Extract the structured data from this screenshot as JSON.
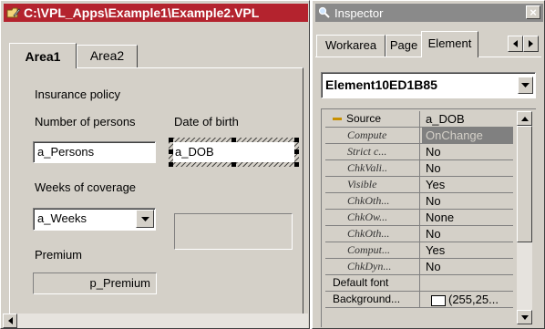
{
  "left_window": {
    "title": "C:\\VPL_Apps\\Example1\\Example2.VPL",
    "tabs": [
      {
        "label": "Area1",
        "active": true
      },
      {
        "label": "Area2",
        "active": false
      }
    ],
    "labels": {
      "insurance_policy": "Insurance policy",
      "number_of_persons": "Number of persons",
      "date_of_birth": "Date of birth",
      "weeks_of_coverage": "Weeks of coverage",
      "premium": "Premium"
    },
    "fields": {
      "persons": "a_Persons",
      "dob": "a_DOB",
      "weeks": "a_Weeks",
      "premium": "p_Premium"
    }
  },
  "inspector": {
    "title": "Inspector",
    "close_glyph": "×",
    "tabs": [
      {
        "label": "Workarea"
      },
      {
        "label": "Page"
      },
      {
        "label": "Element",
        "active": true
      }
    ],
    "element_selector": "Element10ED1B85",
    "properties": [
      {
        "name": "Source",
        "value": "a_DOB",
        "style": "group"
      },
      {
        "name": "Compute",
        "value": "OnChange",
        "style": "child",
        "selected": true
      },
      {
        "name": "Strict c...",
        "value": "No",
        "style": "child"
      },
      {
        "name": "ChkVali..",
        "value": "No",
        "style": "child"
      },
      {
        "name": "Visible",
        "value": "Yes",
        "style": "child"
      },
      {
        "name": "ChkOth...",
        "value": "No",
        "style": "child"
      },
      {
        "name": "ChkOw...",
        "value": "None",
        "style": "child"
      },
      {
        "name": "ChkOth...",
        "value": "No",
        "style": "child"
      },
      {
        "name": "Comput...",
        "value": "Yes",
        "style": "child"
      },
      {
        "name": "ChkDyn...",
        "value": "No",
        "style": "child"
      },
      {
        "name": "Default font",
        "value": "",
        "style": "plain"
      },
      {
        "name": "Background...",
        "value": "(255,25...",
        "style": "plain",
        "swatch": "#ffffff"
      }
    ]
  },
  "colors": {
    "title_active": "#b4232e",
    "title_inactive": "#8a8a8a",
    "face": "#d4d0c8"
  }
}
